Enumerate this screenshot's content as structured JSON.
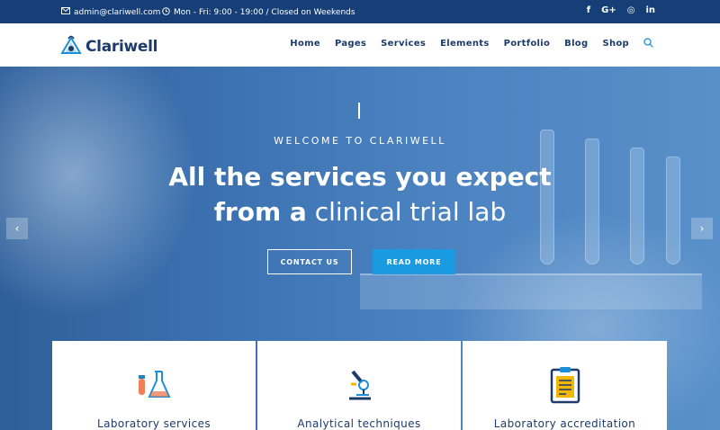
{
  "topbar": {
    "email": "admin@clariwell.com",
    "hours": "Mon - Fri: 9:00 - 19:00 / Closed on Weekends",
    "socials": [
      "f",
      "G+",
      "◎",
      "in"
    ]
  },
  "header": {
    "brand": "Clariwell",
    "nav": [
      "Home",
      "Pages",
      "Services",
      "Elements",
      "Portfolio",
      "Blog",
      "Shop"
    ]
  },
  "hero": {
    "eyebrow": "WELCOME TO CLARIWELL",
    "title_line1": "All the services you expect",
    "title_line2_bold": "from a",
    "title_line2_light": "clinical trial lab",
    "btn_contact": "CONTACT US",
    "btn_read": "READ MORE",
    "prev_arrow": "‹",
    "next_arrow": "›"
  },
  "services": [
    {
      "label": "Laboratory services",
      "icon": "flask-icon"
    },
    {
      "label": "Analytical techniques",
      "icon": "microscope-icon"
    },
    {
      "label": "Laboratory accreditation",
      "icon": "clipboard-icon"
    }
  ],
  "colors": {
    "topbar": "#153f76",
    "brand": "#1d3b6a",
    "accent": "#1a9ae0"
  }
}
